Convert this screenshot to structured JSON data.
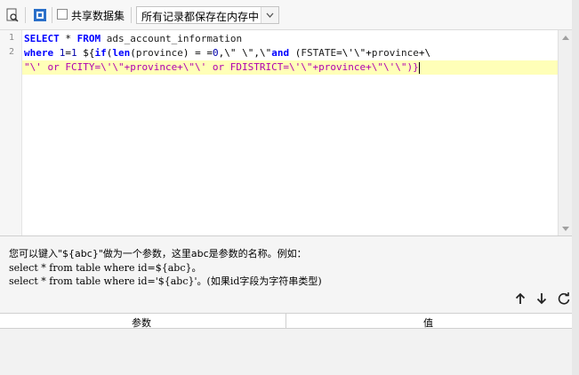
{
  "toolbar": {
    "share_dataset_label": "共享数据集",
    "storage_mode_selected": "所有记录都保存在内存中"
  },
  "editor": {
    "line_numbers": [
      "1",
      "2"
    ],
    "lines": [
      "SELECT * FROM ads_account_information",
      "where 1=1 ${if(len(province) = =0,\\\" \\\",\\\"and (FSTATE=\\'\\\"+province+\\",
      "\"\\' or FCITY=\\'\\\"+province+\\\"\\' or FDISTRICT=\\'\\\"+province+\\\"\\'\\\")}"
    ]
  },
  "hint": {
    "line1": "您可以键入\"${abc}\"做为一个参数，这里abc是参数的名称。例如：",
    "line2": "select * from table where id=${abc}。",
    "line3": "select * from table where id='${abc}'。(如果id字段为字符串类型)"
  },
  "params_table": {
    "col_param": "参数",
    "col_value": "值"
  },
  "colors": {
    "keyword": "#0000ff",
    "string": "#b000b0",
    "highlight": "#ffffb8"
  }
}
